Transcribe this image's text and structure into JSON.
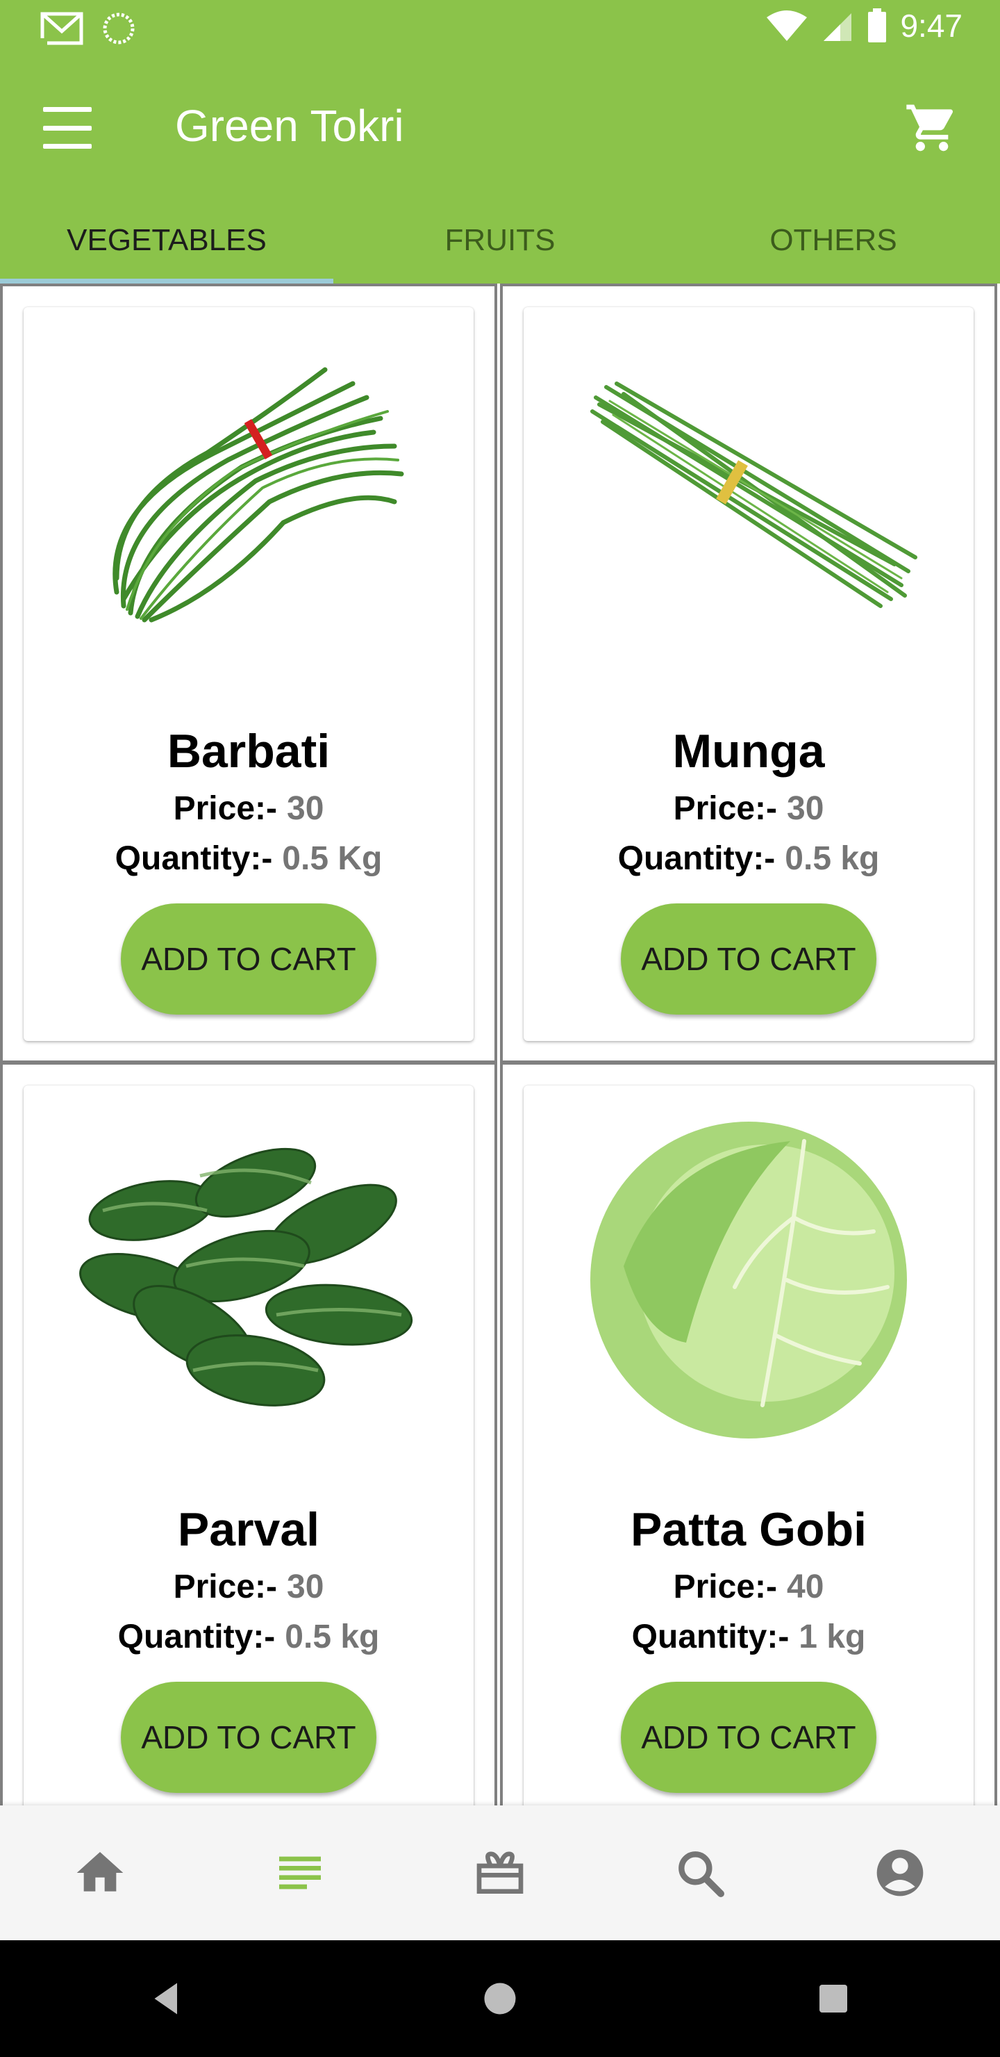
{
  "status_bar": {
    "time": "9:47"
  },
  "app": {
    "title": "Green Tokri"
  },
  "tabs": [
    {
      "label": "VEGETABLES",
      "active": true
    },
    {
      "label": "FRUITS",
      "active": false
    },
    {
      "label": "OTHERS",
      "active": false
    }
  ],
  "products": [
    {
      "name": "Barbati",
      "price_label": "Price:-",
      "price": "30",
      "quantity_label": "Quantity:-",
      "quantity": "0.5 Kg",
      "button": "ADD TO CART",
      "image_icon": "long-beans-image"
    },
    {
      "name": "Munga",
      "price_label": "Price:-",
      "price": "30",
      "quantity_label": "Quantity:-",
      "quantity": "0.5 kg",
      "button": "ADD TO CART",
      "image_icon": "drumsticks-image"
    },
    {
      "name": "Parval",
      "price_label": "Price:-",
      "price": "30",
      "quantity_label": "Quantity:-",
      "quantity": "0.5 kg",
      "button": "ADD TO CART",
      "image_icon": "pointed-gourd-image"
    },
    {
      "name": "Patta Gobi",
      "price_label": "Price:-",
      "price": "40",
      "quantity_label": "Quantity:-",
      "quantity": "1 kg",
      "button": "ADD TO CART",
      "image_icon": "cabbage-image"
    }
  ],
  "bottom_nav": [
    "home-icon",
    "list-icon",
    "gift-icon",
    "search-icon",
    "account-icon"
  ],
  "colors": {
    "primary": "#8bc34a",
    "tab_indicator": "#9ccbd8",
    "value_gray": "#757575"
  }
}
